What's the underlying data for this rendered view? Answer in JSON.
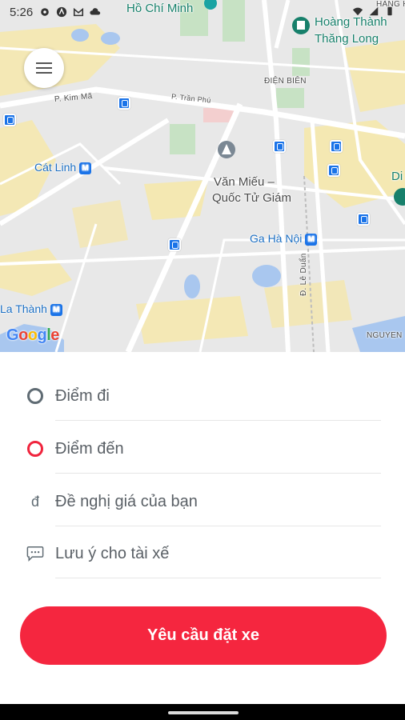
{
  "status_bar": {
    "time": "5:26",
    "icons": [
      "gear-icon",
      "a-circle-icon",
      "gmail-icon",
      "cloud-icon",
      "wifi-icon",
      "signal-icon",
      "battery-icon"
    ]
  },
  "map": {
    "labels": {
      "ho_chi_minh": "Hồ Chí Minh",
      "hoang_thanh_1": "Hoàng Thành",
      "hoang_thanh_2": "Thăng Long",
      "dien_bien": "ĐIỆN BIÊN",
      "kim_ma": "P. Kim Mã",
      "tran_phu": "P. Trần Phú",
      "cat_linh": "Cát Linh",
      "van_mieu_1": "Văn Miếu –",
      "van_mieu_2": "Quốc Tử Giám",
      "ga_ha_noi": "Ga Hà Nội",
      "la_thanh": "La Thành",
      "le_duan": "Đ. Lê Duẩn",
      "nguyen": "NGUYEN",
      "hang": "HÀNG H",
      "di": "Di"
    },
    "metro_letter": "M",
    "google_logo": "Google",
    "colors": {
      "road_major": "#f7e7a5",
      "road": "#ffffff",
      "park": "#c8e6c9",
      "water": "#aac8f0",
      "poi_teal": "#17806b",
      "transit_blue": "#1a73e8"
    }
  },
  "form": {
    "pickup_placeholder": "Điểm đi",
    "dropoff_placeholder": "Điểm đến",
    "price_currency": "đ",
    "price_placeholder": "Đề nghị giá của bạn",
    "note_placeholder": "Lưu ý cho tài xế",
    "submit_label": "Yêu cầu đặt xe",
    "accent_color": "#f5263f"
  }
}
